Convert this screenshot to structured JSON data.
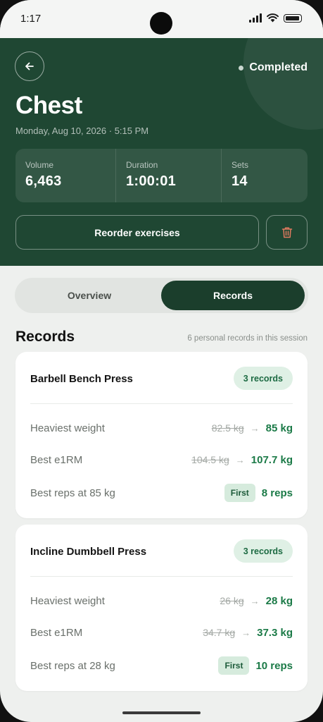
{
  "status_bar": {
    "time": "1:17"
  },
  "header": {
    "status": "Completed",
    "title": "Chest",
    "datetime": "Monday, Aug 10, 2026 · 5:15 PM",
    "stats": [
      {
        "label": "Volume",
        "value": "6,463"
      },
      {
        "label": "Duration",
        "value": "1:00:01"
      },
      {
        "label": "Sets",
        "value": "14"
      }
    ],
    "reorder_label": "Reorder exercises"
  },
  "tabs": {
    "overview": "Overview",
    "records": "Records",
    "active": "Records"
  },
  "records_section": {
    "title": "Records",
    "subtitle": "6 personal records in this session"
  },
  "exercises": [
    {
      "name": "Barbell Bench Press",
      "badge": "3 records",
      "rows": [
        {
          "label": "Heaviest weight",
          "old": "82.5 kg",
          "new": "85 kg"
        },
        {
          "label": "Best e1RM",
          "old": "104.5 kg",
          "new": "107.7 kg"
        },
        {
          "label": "Best reps at 85 kg",
          "tag": "First",
          "new": "8 reps"
        }
      ]
    },
    {
      "name": "Incline Dumbbell Press",
      "badge": "3 records",
      "rows": [
        {
          "label": "Heaviest weight",
          "old": "26 kg",
          "new": "28 kg"
        },
        {
          "label": "Best e1RM",
          "old": "34.7 kg",
          "new": "37.3 kg"
        },
        {
          "label": "Best reps at 28 kg",
          "tag": "First",
          "new": "10 reps"
        }
      ]
    }
  ],
  "arrow_glyph": "→",
  "icons": {
    "back": "arrow-left-icon",
    "delete": "trash-icon"
  },
  "colors": {
    "header_bg": "#1f4733",
    "accent_green": "#1b7a47",
    "delete_red": "#e07a5f"
  }
}
